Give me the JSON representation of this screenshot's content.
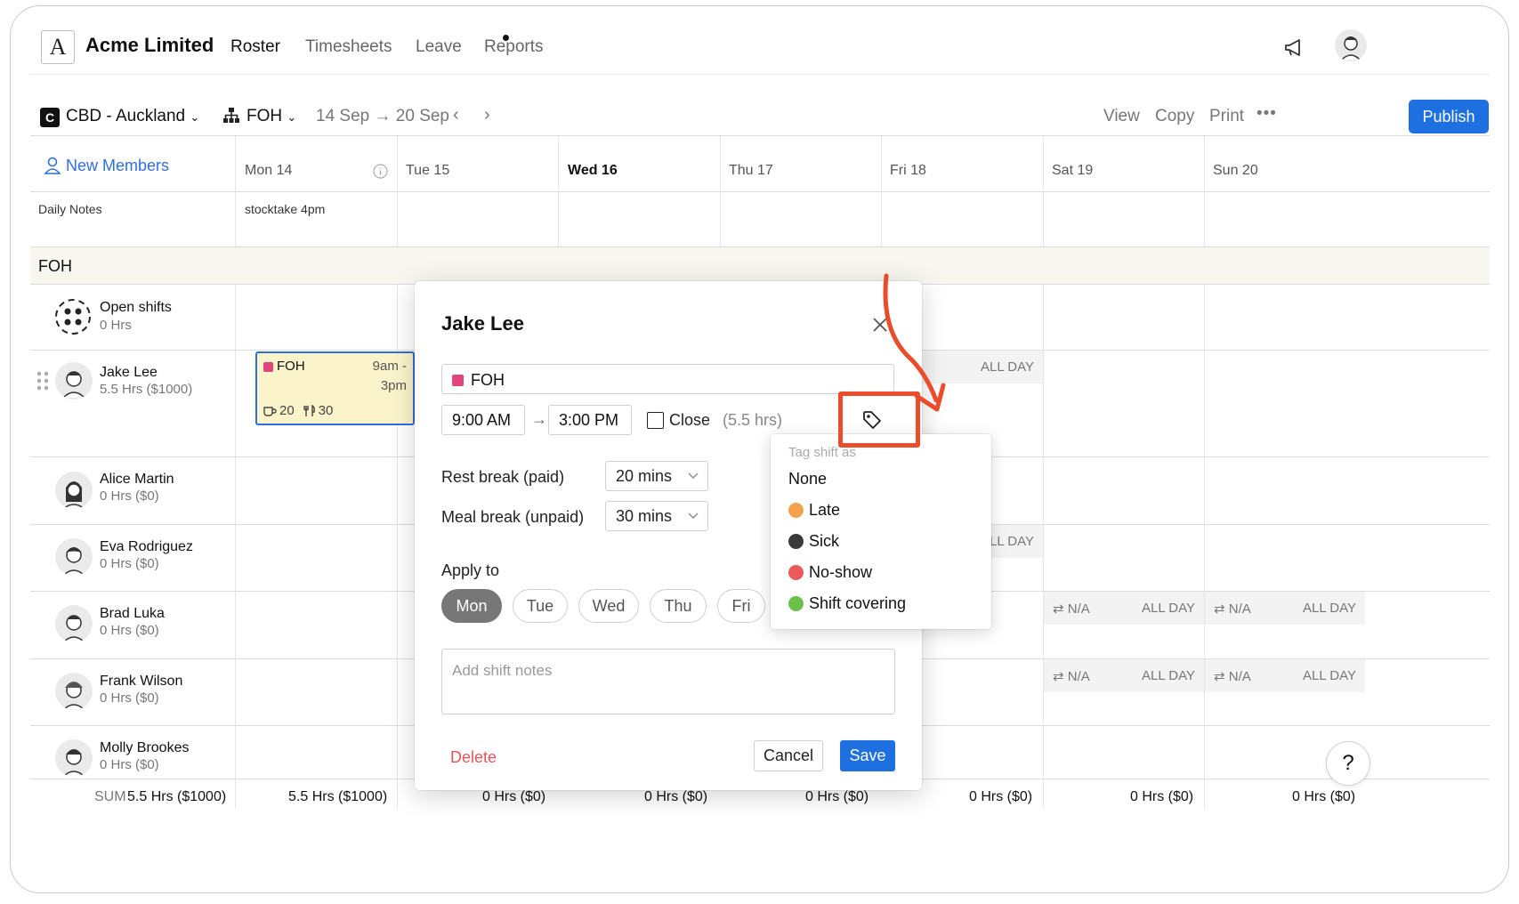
{
  "app": {
    "company": "Acme Limited"
  },
  "nav": {
    "roster": "Roster",
    "timesheets": "Timesheets",
    "leave": "Leave",
    "reports": "Reports"
  },
  "toolbar": {
    "location_badge": "C",
    "location": "CBD - Auckland",
    "department": "FOH",
    "date_range": "14 Sep → 20 Sep",
    "view": "View",
    "copy": "Copy",
    "print": "Print",
    "more": "•••",
    "publish": "Publish"
  },
  "grid": {
    "new_members": "New Members",
    "days": [
      "Mon 14",
      "Tue 15",
      "Wed 16",
      "Thu 17",
      "Fri 18",
      "Sat 19",
      "Sun 20"
    ],
    "daily_notes_label": "Daily Notes",
    "daily_notes": {
      "mon": "stocktake 4pm"
    },
    "section": "FOH",
    "open_shifts": {
      "name": "Open shifts",
      "hours": "0 Hrs"
    },
    "employees": [
      {
        "name": "Jake Lee",
        "hours": "5.5 Hrs ($1000)"
      },
      {
        "name": "Alice Martin",
        "hours": "0 Hrs ($0)"
      },
      {
        "name": "Eva Rodriguez",
        "hours": "0 Hrs ($0)"
      },
      {
        "name": "Brad Luka",
        "hours": "0 Hrs ($0)"
      },
      {
        "name": "Frank Wilson",
        "hours": "0 Hrs ($0)"
      },
      {
        "name": "Molly Brookes",
        "hours": "0 Hrs ($0)"
      }
    ],
    "leave": {
      "na": "N/A",
      "na_partial": "/A",
      "all_day": "ALL DAY"
    },
    "shift": {
      "role": "FOH",
      "time_top": "9am -",
      "time_bottom": "3pm",
      "rest": "20",
      "meal": "30",
      "color": "#e0457b"
    },
    "sum": {
      "label": "SUM",
      "total": "5.5 Hrs ($1000)",
      "mon": "5.5 Hrs ($1000)",
      "tue": "0 Hrs ($0)",
      "wed": "0 Hrs ($0)",
      "thu": "0 Hrs ($0)",
      "fri": "0 Hrs ($0)",
      "sat": "0 Hrs ($0)",
      "sun": "0 Hrs ($0)"
    }
  },
  "modal": {
    "title": "Jake Lee",
    "role": "FOH",
    "start": "9:00 AM",
    "end": "3:00 PM",
    "close_label": "Close",
    "duration": "(5.5 hrs)",
    "rest_label": "Rest break (paid)",
    "rest_value": "20 mins",
    "meal_label": "Meal break (unpaid)",
    "meal_value": "30 mins",
    "apply_label": "Apply to",
    "apply_days": [
      "Mon",
      "Tue",
      "Wed",
      "Thu",
      "Fri"
    ],
    "notes_placeholder": "Add shift notes",
    "delete": "Delete",
    "cancel": "Cancel",
    "save": "Save"
  },
  "tag_menu": {
    "header": "Tag shift as",
    "options": [
      {
        "label": "None",
        "color": ""
      },
      {
        "label": "Late",
        "color": "#f3a24d"
      },
      {
        "label": "Sick",
        "color": "#3a3a3a"
      },
      {
        "label": "No-show",
        "color": "#ea5a5a"
      },
      {
        "label": "Shift covering",
        "color": "#6cc04a"
      }
    ]
  },
  "help": {
    "label": "?"
  },
  "colors": {
    "accent": "#1e6fe0",
    "highlight": "#ea4d2c",
    "band": "#f7f6ef"
  }
}
